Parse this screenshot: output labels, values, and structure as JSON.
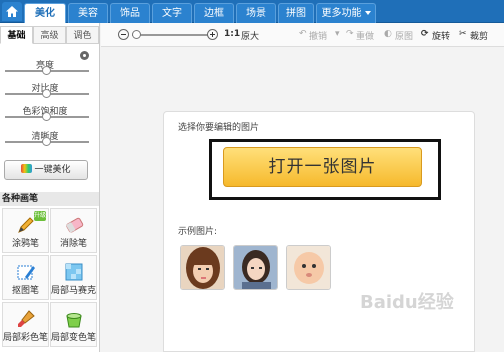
{
  "topbar": {
    "tabs": [
      {
        "label": "美化",
        "active": true
      },
      {
        "label": "美容",
        "active": false
      },
      {
        "label": "饰品",
        "active": false
      },
      {
        "label": "文字",
        "active": false
      },
      {
        "label": "边框",
        "active": false
      },
      {
        "label": "场景",
        "active": false
      },
      {
        "label": "拼图",
        "active": false
      },
      {
        "label": "更多功能",
        "active": false
      }
    ],
    "home_icon": "home-icon"
  },
  "leftpanel": {
    "subtabs": [
      "基础",
      "高级",
      "调色"
    ],
    "sliders": [
      {
        "label": "亮度",
        "value": 0.5
      },
      {
        "label": "对比度",
        "value": 0.5
      },
      {
        "label": "色彩饱和度",
        "value": 0.5
      },
      {
        "label": "清晰度",
        "value": 0.5
      }
    ],
    "one_key_label": "一键美化",
    "brush_section_title": "各种画笔",
    "tools": [
      {
        "label": "涂鸦笔",
        "icon": "pencil-icon",
        "badge": "升级"
      },
      {
        "label": "消除笔",
        "icon": "eraser-icon"
      },
      {
        "label": "抠图笔",
        "icon": "cutout-pen-icon"
      },
      {
        "label": "局部马赛克",
        "icon": "mosaic-icon"
      },
      {
        "label": "局部彩色笔",
        "icon": "color-brush-icon"
      },
      {
        "label": "局部变色笔",
        "icon": "paint-bucket-icon"
      }
    ]
  },
  "toolbar": {
    "zoom_value": 0,
    "ratio_label": "1:1",
    "original_size_label": "原大",
    "undo_label": "撤销",
    "redo_label": "重做",
    "compare_label": "原图",
    "rotate_label": "旋转",
    "crop_label": "裁剪"
  },
  "canvas": {
    "prompt_label": "选择你要编辑的图片",
    "open_button_label": "打开一张图片",
    "samples_label": "示例图片:",
    "sample_images": [
      "sample-photo-woman-bangs",
      "sample-photo-woman-portrait",
      "sample-photo-baby"
    ]
  },
  "watermark": "Baidu经验",
  "colors": {
    "topbar": "#1f6fb8",
    "open_button_top": "#ffe07a",
    "open_button_bottom": "#f6b92c"
  }
}
